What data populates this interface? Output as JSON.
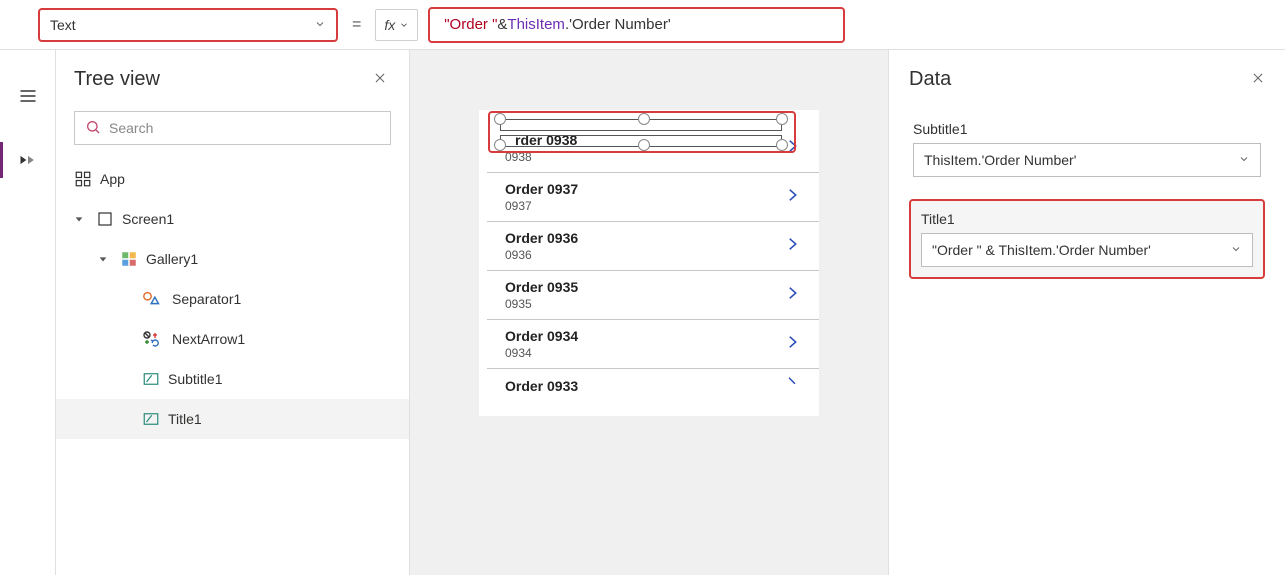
{
  "formula_bar": {
    "property": "Text",
    "fx_label": "fx",
    "formula_tokens": {
      "str": "\"Order \"",
      "op1": " & ",
      "obj": "ThisItem",
      "dot": ".",
      "field": "'Order Number'"
    },
    "equals": "="
  },
  "tree": {
    "title": "Tree view",
    "search_placeholder": "Search",
    "items": {
      "app": "App",
      "screen": "Screen1",
      "gallery": "Gallery1",
      "separator": "Separator1",
      "nextarrow": "NextArrow1",
      "subtitle": "Subtitle1",
      "title": "Title1"
    }
  },
  "gallery": [
    {
      "title": "Order 0938",
      "subtitle": "0938",
      "cut": false
    },
    {
      "title": "Order 0937",
      "subtitle": "0937",
      "cut": false
    },
    {
      "title": "Order 0936",
      "subtitle": "0936",
      "cut": false
    },
    {
      "title": "Order 0935",
      "subtitle": "0935",
      "cut": false
    },
    {
      "title": "Order 0934",
      "subtitle": "0934",
      "cut": false
    },
    {
      "title": "Order 0933",
      "subtitle": "",
      "cut": true
    }
  ],
  "data_panel": {
    "title": "Data",
    "fields": {
      "subtitle_label": "Subtitle1",
      "subtitle_value": "ThisItem.'Order Number'",
      "title_label": "Title1",
      "title_value": "\"Order \" & ThisItem.'Order Number'"
    }
  }
}
